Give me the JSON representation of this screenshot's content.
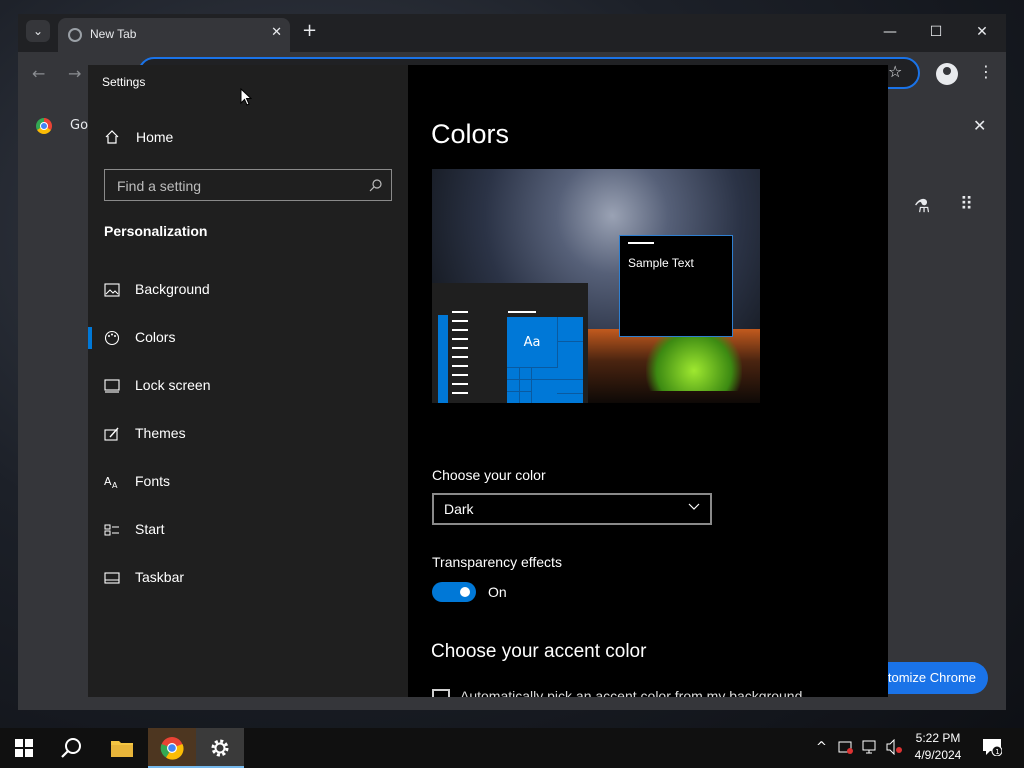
{
  "chrome": {
    "tab_title": "New Tab",
    "tab_close": "✕",
    "new_tab": "+",
    "minimize": "—",
    "maximize": "☐",
    "close": "✕",
    "back": "←",
    "forward": "→",
    "star": "☆",
    "menu": "⋮",
    "bookmark_text": "Go",
    "bookmark_close": "✕",
    "customize_label": "ıtomize Chrome"
  },
  "settings": {
    "window_title": "Settings",
    "home_label": "Home",
    "search_placeholder": "Find a setting",
    "section_title": "Personalization",
    "nav": [
      {
        "label": "Background",
        "icon": "picture-icon"
      },
      {
        "label": "Colors",
        "icon": "palette-icon",
        "selected": true
      },
      {
        "label": "Lock screen",
        "icon": "lock-screen-icon"
      },
      {
        "label": "Themes",
        "icon": "brush-icon"
      },
      {
        "label": "Fonts",
        "icon": "font-icon"
      },
      {
        "label": "Start",
        "icon": "start-icon"
      },
      {
        "label": "Taskbar",
        "icon": "taskbar-icon"
      }
    ],
    "page_title": "Colors",
    "preview_sample_text": "Sample Text",
    "preview_tile_text": "Aa",
    "choose_color_label": "Choose your color",
    "choose_color_value": "Dark",
    "transparency_label": "Transparency effects",
    "transparency_state": "On",
    "transparency_on": true,
    "accent_title": "Choose your accent color",
    "accent_checkbox_label": "Automatically pick an accent color from my background",
    "accent_color": "#0078d7"
  },
  "taskbar": {
    "time": "5:22 PM",
    "date": "4/9/2024",
    "notification_count": "1",
    "tray_up": "^"
  }
}
